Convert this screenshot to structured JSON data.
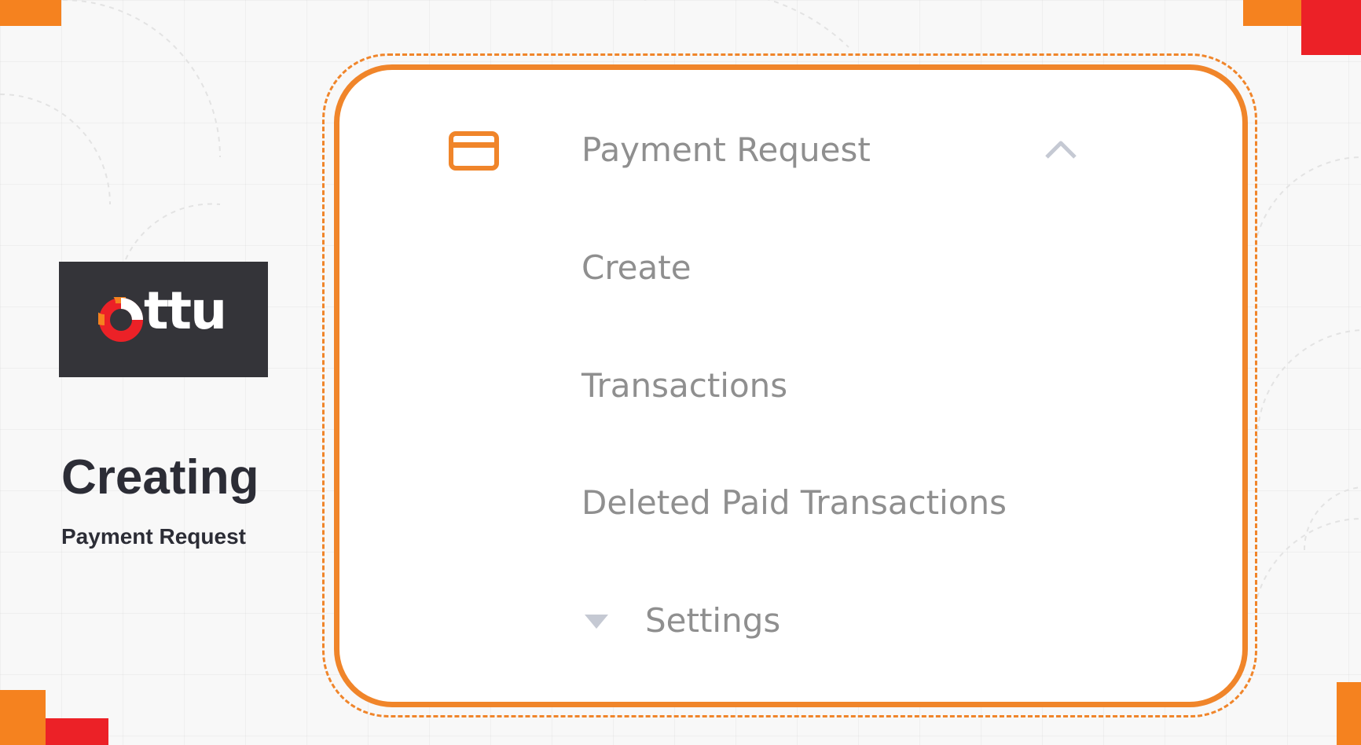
{
  "brand": {
    "logo_text": "ttu",
    "colors": {
      "orange": "#f5821f",
      "red": "#ec2127",
      "dark": "#343439"
    }
  },
  "side": {
    "title": "Creating",
    "subtitle": "Payment Request"
  },
  "menu": {
    "header": {
      "label": "Payment Request",
      "icon": "credit-card-icon",
      "toggle_icon": "chevron-up-icon"
    },
    "items": [
      {
        "label": "Create"
      },
      {
        "label": "Transactions"
      },
      {
        "label": "Deleted Paid Transactions"
      }
    ],
    "settings": {
      "label": "Settings",
      "icon": "caret-down-icon"
    }
  }
}
